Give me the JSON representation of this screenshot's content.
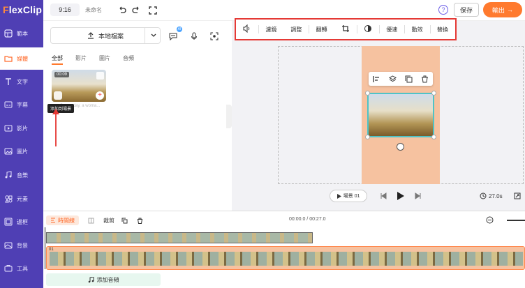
{
  "brand": {
    "logo_mark": "F",
    "logo_rest": "lexClip"
  },
  "sidebar": {
    "items": [
      {
        "label": "範本",
        "icon": "template-icon"
      },
      {
        "label": "媒體",
        "icon": "folder-icon",
        "active": true
      },
      {
        "label": "文字",
        "icon": "text-icon"
      },
      {
        "label": "字幕",
        "icon": "subtitle-icon"
      },
      {
        "label": "影片",
        "icon": "video-icon"
      },
      {
        "label": "圖片",
        "icon": "image-icon"
      },
      {
        "label": "音樂",
        "icon": "music-icon"
      },
      {
        "label": "元素",
        "icon": "elements-icon"
      },
      {
        "label": "邊框",
        "icon": "overlay-icon"
      },
      {
        "label": "背景",
        "icon": "background-icon"
      },
      {
        "label": "工具",
        "icon": "tools-icon"
      }
    ]
  },
  "topbar": {
    "aspect": "9:16",
    "project_name": "未命名",
    "help": "?",
    "save_label": "保存",
    "export_label": "輸出",
    "export_arrow": "→"
  },
  "panel": {
    "upload_label": "本地檔案",
    "ai_badge": "AI",
    "tabs": [
      "全部",
      "影片",
      "圖片",
      "音頻"
    ],
    "media": {
      "duration": "00:09",
      "caption": "Sunny day, a woma...",
      "tooltip": "添加到場景"
    }
  },
  "edit_toolbar": {
    "tools": [
      "濾鏡",
      "調整",
      "翻轉",
      "優速",
      "動效",
      "替換"
    ]
  },
  "player": {
    "scene_label": "場景 01",
    "duration": "27.0s"
  },
  "timeline": {
    "timeline_label": "時間線",
    "split_label": "裁剪",
    "time_readout": "00:00.0 / 00:27.0",
    "track_number": "01",
    "add_audio_label": "添加音頻"
  },
  "colors": {
    "sidebar": "#4f3fb4",
    "accent": "#ff7a2e",
    "stage_bg": "#f6c2a0",
    "highlight_border": "#e53935"
  }
}
